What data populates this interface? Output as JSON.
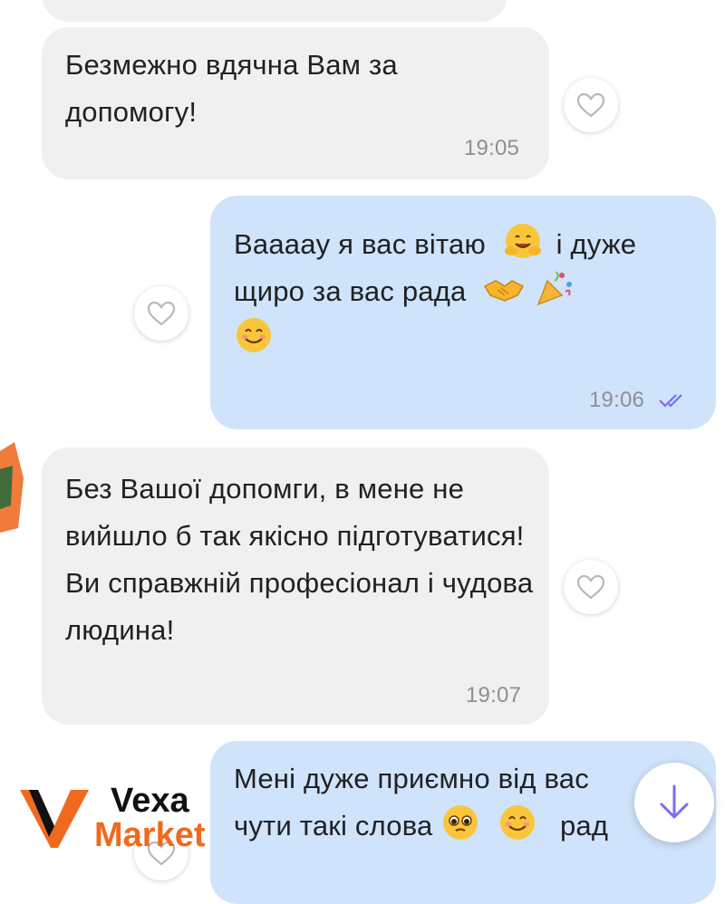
{
  "messages": [
    {
      "text": "Безмежно вдячна Вам за допомогу!",
      "time": "19:05"
    },
    {
      "text_parts": [
        "Вааааy я вас вітаю",
        "і дуже",
        "щиро за вас рада"
      ],
      "time": "19:06"
    },
    {
      "text": "Без Вашої допомги, в мене не вийшло б так якісно підготуватися! Ви справжній професіонал і чудова людина!",
      "time": "19:07"
    },
    {
      "text_parts": [
        "Мені дуже приємно від вас",
        "чути такі слова",
        "рад"
      ]
    }
  ],
  "icons": {
    "heart": "heart-outline-icon",
    "read_receipt": "double-check-icon",
    "scroll_down": "arrow-down-icon"
  },
  "watermark": {
    "line1": "Vexa",
    "line2": "Market"
  },
  "colors": {
    "incoming": "#f0f0f1",
    "outgoing": "#cfe3fb",
    "accent": "#7b6cf6",
    "brand_orange": "#f06a1d"
  }
}
